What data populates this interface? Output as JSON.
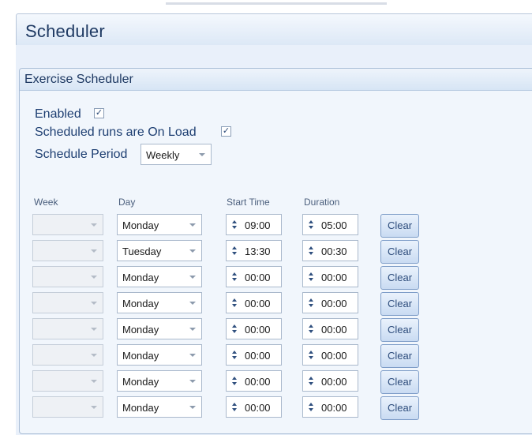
{
  "header": {
    "title": "Scheduler"
  },
  "group": {
    "title": "Exercise Scheduler",
    "enabled": {
      "label": "Enabled",
      "checked": true
    },
    "on_load": {
      "label": "Scheduled runs are On Load",
      "checked": true
    },
    "period": {
      "label": "Schedule Period",
      "value": "Weekly"
    }
  },
  "table": {
    "headers": {
      "week": "Week",
      "day": "Day",
      "start": "Start Time",
      "duration": "Duration"
    },
    "clear_label": "Clear",
    "rows": [
      {
        "week": "",
        "day": "Monday",
        "start": "09:00",
        "duration": "05:00"
      },
      {
        "week": "",
        "day": "Tuesday",
        "start": "13:30",
        "duration": "00:30"
      },
      {
        "week": "",
        "day": "Monday",
        "start": "00:00",
        "duration": "00:00"
      },
      {
        "week": "",
        "day": "Monday",
        "start": "00:00",
        "duration": "00:00"
      },
      {
        "week": "",
        "day": "Monday",
        "start": "00:00",
        "duration": "00:00"
      },
      {
        "week": "",
        "day": "Monday",
        "start": "00:00",
        "duration": "00:00"
      },
      {
        "week": "",
        "day": "Monday",
        "start": "00:00",
        "duration": "00:00"
      },
      {
        "week": "",
        "day": "Monday",
        "start": "00:00",
        "duration": "00:00"
      }
    ]
  },
  "icons": {
    "check": "checkbox-check-icon",
    "dropdown": "chevron-down-icon",
    "spinner": "spin-arrows-icon"
  }
}
